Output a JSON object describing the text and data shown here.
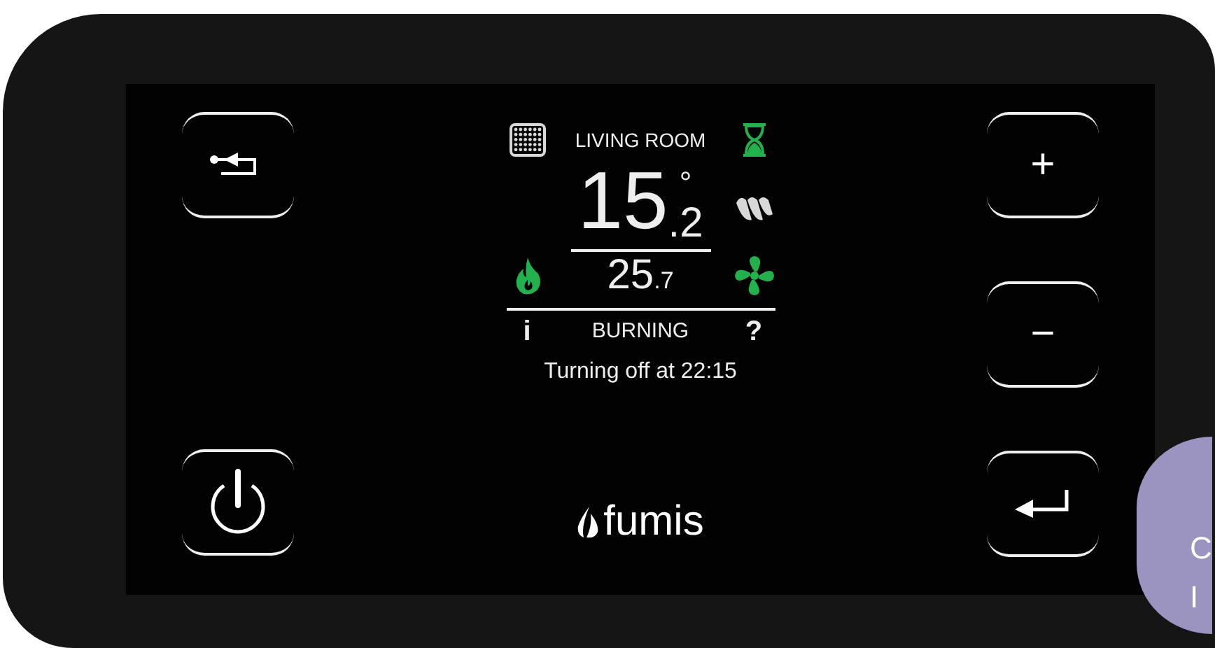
{
  "left_buttons": [
    {
      "kind": "back"
    },
    {
      "kind": "power"
    }
  ],
  "screen": {
    "room": "LIVING ROOM",
    "temperature": {
      "whole": "15",
      "decimal": ".2",
      "unit": "°"
    },
    "setpoint": {
      "whole": "25",
      "decimal": ".7"
    },
    "indicators": [
      {
        "kind": "pellet",
        "on": false
      },
      {
        "kind": "timer",
        "on": true
      },
      {
        "kind": "wave",
        "on": false
      },
      {
        "kind": "flame",
        "on": true
      },
      {
        "kind": "fan",
        "on": true
      }
    ],
    "info": "i",
    "status": "BURNING",
    "help": "?",
    "message": "Turning off at 22:15"
  },
  "brand": "fumis",
  "right_buttons": [
    {
      "kind": "plus",
      "label": "+"
    },
    {
      "kind": "minus",
      "label": "−"
    },
    {
      "kind": "enter"
    }
  ],
  "chat_bubble": {
    "lines": [
      "C",
      "I"
    ]
  }
}
